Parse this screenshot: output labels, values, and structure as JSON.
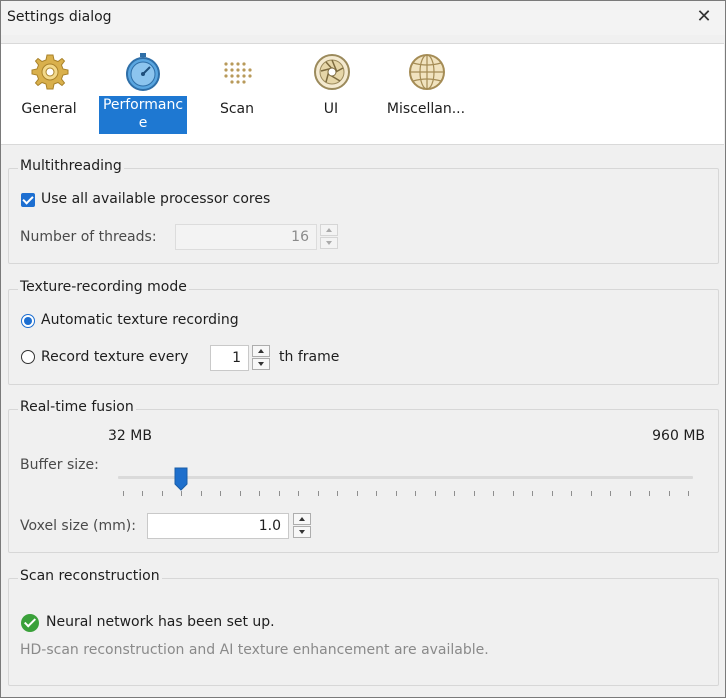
{
  "window": {
    "title": "Settings dialog"
  },
  "toolbar": {
    "items": [
      {
        "label": "General",
        "icon": "gear-icon",
        "selected": false
      },
      {
        "label": "Performance",
        "icon": "stopwatch-icon",
        "selected": true
      },
      {
        "label": "Scan",
        "icon": "scan-dots-icon",
        "selected": false
      },
      {
        "label": "UI",
        "icon": "aperture-icon",
        "selected": false
      },
      {
        "label": "Miscellan...",
        "icon": "globe-icon",
        "selected": false
      }
    ]
  },
  "multithreading": {
    "title": "Multithreading",
    "use_all_cores_label": "Use all available processor cores",
    "use_all_cores_checked": true,
    "threads_label": "Number of threads:",
    "threads_value": "16"
  },
  "texture": {
    "title": "Texture-recording mode",
    "auto_label": "Automatic texture recording",
    "every_label": "Record texture every",
    "every_value": "1",
    "every_suffix": "th frame",
    "selected": "auto"
  },
  "fusion": {
    "title": "Real-time fusion",
    "min_label": "32 MB",
    "max_label": "960 MB",
    "buffer_label": "Buffer size:",
    "buffer_fraction": 0.11,
    "voxel_label": "Voxel size (mm):",
    "voxel_value": "1.0"
  },
  "reconstruction": {
    "title": "Scan reconstruction",
    "status": "Neural network has been set up.",
    "info": "HD-scan reconstruction and AI texture enhancement are available."
  },
  "colors": {
    "accent": "#1e78d2",
    "success": "#3aa13a"
  }
}
